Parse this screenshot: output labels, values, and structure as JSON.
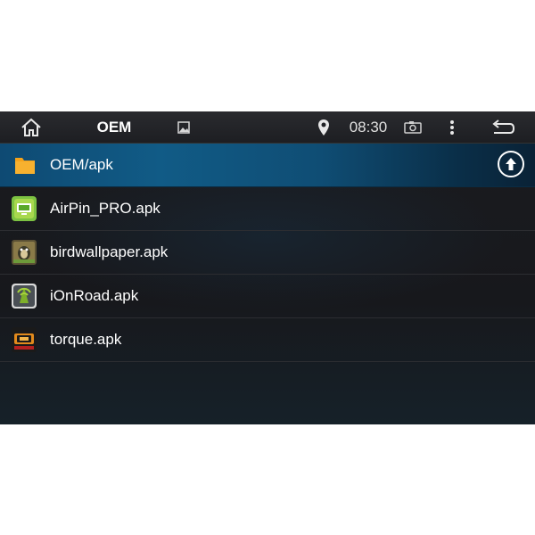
{
  "statusbar": {
    "title": "OEM",
    "time": "08:30",
    "icons": [
      "home-icon",
      "gallery-icon",
      "location-icon",
      "screenshot-icon",
      "menu-icon",
      "back-icon"
    ]
  },
  "path": {
    "label": "OEM/apk",
    "folder_icon": "folder-icon",
    "up_icon": "up-arrow-icon"
  },
  "files": [
    {
      "name": "AirPin_PRO.apk",
      "icon": "airpin-app-icon"
    },
    {
      "name": "birdwallpaper.apk",
      "icon": "birdwallpaper-app-icon"
    },
    {
      "name": "iOnRoad.apk",
      "icon": "ionroad-app-icon"
    },
    {
      "name": "torque.apk",
      "icon": "torque-app-icon"
    }
  ],
  "colors": {
    "accent": "#115b86",
    "folder": "#f5a21a",
    "text": "#ffffff"
  }
}
